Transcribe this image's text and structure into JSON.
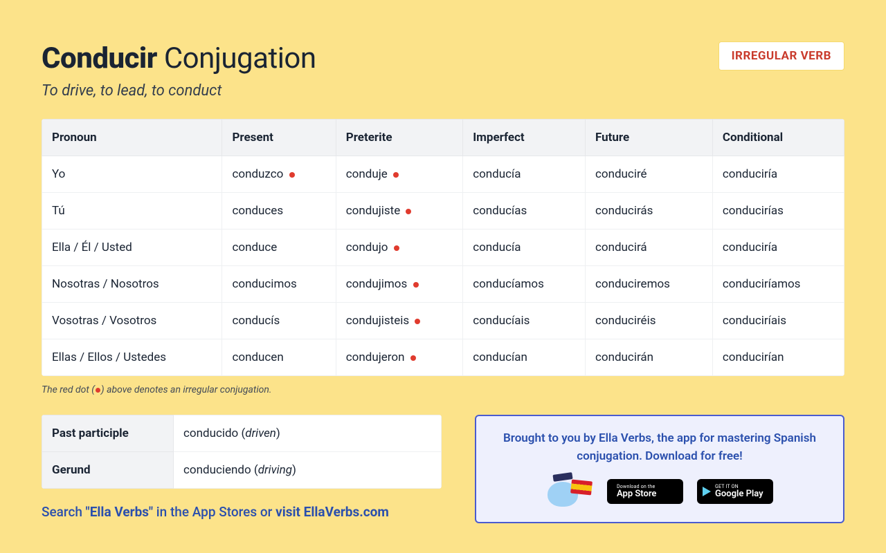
{
  "header": {
    "title_bold": "Conducir",
    "title_rest": " Conjugation",
    "subtitle": "To drive, to lead, to conduct",
    "badge": "IRREGULAR VERB"
  },
  "table": {
    "headers": [
      "Pronoun",
      "Present",
      "Preterite",
      "Imperfect",
      "Future",
      "Conditional"
    ],
    "rows": [
      {
        "pronoun": "Yo",
        "cells": [
          {
            "v": "conduzco",
            "irr": true
          },
          {
            "v": "conduje",
            "irr": true
          },
          {
            "v": "conducía",
            "irr": false
          },
          {
            "v": "conduciré",
            "irr": false
          },
          {
            "v": "conduciría",
            "irr": false
          }
        ]
      },
      {
        "pronoun": "Tú",
        "cells": [
          {
            "v": "conduces",
            "irr": false
          },
          {
            "v": "condujiste",
            "irr": true
          },
          {
            "v": "conducías",
            "irr": false
          },
          {
            "v": "conducirás",
            "irr": false
          },
          {
            "v": "conducirías",
            "irr": false
          }
        ]
      },
      {
        "pronoun": "Ella / Él / Usted",
        "cells": [
          {
            "v": "conduce",
            "irr": false
          },
          {
            "v": "condujo",
            "irr": true
          },
          {
            "v": "conducía",
            "irr": false
          },
          {
            "v": "conducirá",
            "irr": false
          },
          {
            "v": "conduciría",
            "irr": false
          }
        ]
      },
      {
        "pronoun": "Nosotras / Nosotros",
        "cells": [
          {
            "v": "conducimos",
            "irr": false
          },
          {
            "v": "condujimos",
            "irr": true
          },
          {
            "v": "conducíamos",
            "irr": false
          },
          {
            "v": "conduciremos",
            "irr": false
          },
          {
            "v": "conduciríamos",
            "irr": false
          }
        ]
      },
      {
        "pronoun": "Vosotras / Vosotros",
        "cells": [
          {
            "v": "conducís",
            "irr": false
          },
          {
            "v": "condujisteis",
            "irr": true
          },
          {
            "v": "conducíais",
            "irr": false
          },
          {
            "v": "conduciréis",
            "irr": false
          },
          {
            "v": "conduciríais",
            "irr": false
          }
        ]
      },
      {
        "pronoun": "Ellas / Ellos / Ustedes",
        "cells": [
          {
            "v": "conducen",
            "irr": false
          },
          {
            "v": "condujeron",
            "irr": true
          },
          {
            "v": "conducían",
            "irr": false
          },
          {
            "v": "conducirán",
            "irr": false
          },
          {
            "v": "conducirían",
            "irr": false
          }
        ]
      }
    ]
  },
  "caption": {
    "pre": "The red dot (",
    "post": ") above denotes an irregular conjugation."
  },
  "forms": {
    "past_participle_label": "Past participle",
    "past_participle_value": "conducido (",
    "past_participle_em": "driven",
    "past_participle_close": ")",
    "gerund_label": "Gerund",
    "gerund_value": "conduciendo (",
    "gerund_em": "driving",
    "gerund_close": ")"
  },
  "search_line": {
    "a": "Search ",
    "b": "\"Ella Verbs\"",
    "c": " in the App Stores or ",
    "d": "visit EllaVerbs.com"
  },
  "promo": {
    "text": "Brought to you by Ella Verbs, the app for mastering Spanish conjugation. Download for free!",
    "appstore_small": "Download on the",
    "appstore_big": "App Store",
    "play_small": "GET IT ON",
    "play_big": "Google Play"
  }
}
